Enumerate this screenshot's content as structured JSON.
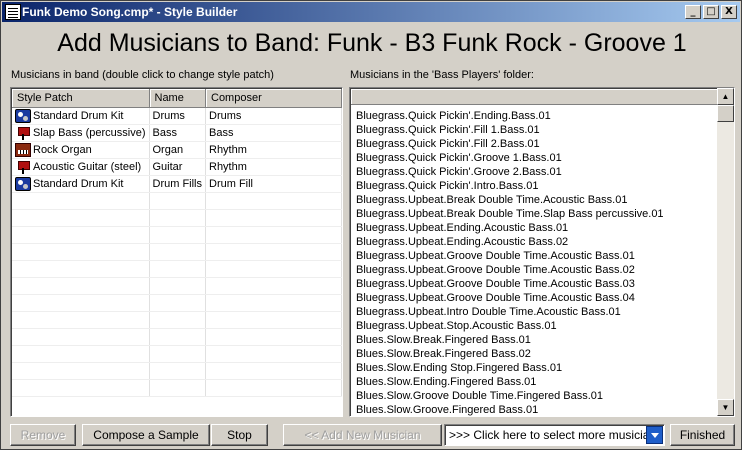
{
  "window": {
    "title": "Funk Demo Song.cmp* - Style Builder",
    "buttons": {
      "minimize": "_",
      "maximize": "□",
      "close": "X"
    }
  },
  "heading": "Add Musicians to Band: Funk - B3 Funk Rock - Groove 1",
  "left": {
    "label": "Musicians in band (double click to change style patch)",
    "columns": [
      "Style Patch",
      "Name",
      "Composer"
    ],
    "rows": [
      {
        "icon": "drum-kit-icon",
        "patch": "Standard Drum Kit",
        "name": "Drums",
        "composer": "Drums"
      },
      {
        "icon": "bass-guitar-icon",
        "patch": "Slap Bass (percussive)",
        "name": "Bass",
        "composer": "Bass"
      },
      {
        "icon": "organ-icon",
        "patch": "Rock Organ",
        "name": "Organ",
        "composer": "Rhythm"
      },
      {
        "icon": "acoustic-guitar-icon",
        "patch": "Acoustic Guitar (steel)",
        "name": "Guitar",
        "composer": "Rhythm"
      },
      {
        "icon": "drum-kit-icon",
        "patch": "Standard Drum Kit",
        "name": "Drum Fills",
        "composer": "Drum Fill"
      }
    ]
  },
  "right": {
    "label": "Musicians in the 'Bass Players' folder:",
    "items": [
      "Bluegrass.Quick Pickin'.Ending.Bass.01",
      "Bluegrass.Quick Pickin'.Fill 1.Bass.01",
      "Bluegrass.Quick Pickin'.Fill 2.Bass.01",
      "Bluegrass.Quick Pickin'.Groove 1.Bass.01",
      "Bluegrass.Quick Pickin'.Groove 2.Bass.01",
      "Bluegrass.Quick Pickin'.Intro.Bass.01",
      "Bluegrass.Upbeat.Break Double Time.Acoustic Bass.01",
      "Bluegrass.Upbeat.Break Double Time.Slap Bass percussive.01",
      "Bluegrass.Upbeat.Ending.Acoustic Bass.01",
      "Bluegrass.Upbeat.Ending.Acoustic Bass.02",
      "Bluegrass.Upbeat.Groove Double Time.Acoustic Bass.01",
      "Bluegrass.Upbeat.Groove Double Time.Acoustic Bass.02",
      "Bluegrass.Upbeat.Groove Double Time.Acoustic Bass.03",
      "Bluegrass.Upbeat.Groove Double Time.Acoustic Bass.04",
      "Bluegrass.Upbeat.Intro Double Time.Acoustic Bass.01",
      "Bluegrass.Upbeat.Stop.Acoustic Bass.01",
      "Blues.Slow.Break.Fingered Bass.01",
      "Blues.Slow.Break.Fingered Bass.02",
      "Blues.Slow.Ending Stop.Fingered Bass.01",
      "Blues.Slow.Ending.Fingered Bass.01",
      "Blues.Slow.Groove Double Time.Fingered Bass.01",
      "Blues.Slow.Groove.Fingered Bass.01"
    ]
  },
  "buttons": {
    "remove": "Remove",
    "compose": "Compose a Sample",
    "stop": "Stop",
    "add_new": "<< Add New Musician",
    "finished": "Finished"
  },
  "combo": {
    "value": ">>> Click here to select more musicians"
  }
}
